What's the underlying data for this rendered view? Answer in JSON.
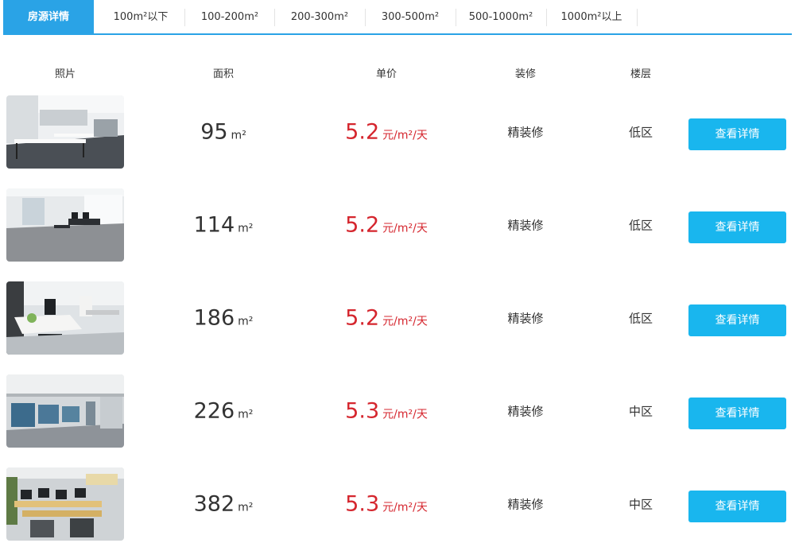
{
  "tabs": [
    {
      "label": "房源详情"
    },
    {
      "label": "100m²以下"
    },
    {
      "label": "100-200m²"
    },
    {
      "label": "200-300m²"
    },
    {
      "label": "300-500m²"
    },
    {
      "label": "500-1000m²"
    },
    {
      "label": "1000m²以上"
    }
  ],
  "columns": {
    "photo": "照片",
    "area": "面积",
    "price": "单价",
    "decoration": "装修",
    "floor": "楼层"
  },
  "colors": {
    "tab_active": "#2aa3e6",
    "price": "#d5262e",
    "button": "#19b6ee"
  },
  "listings": [
    {
      "area": "95",
      "area_unit": "m²",
      "price": "5.2",
      "price_unit": "元/m²/天",
      "decoration": "精装修",
      "floor": "低区",
      "button": "查看详情"
    },
    {
      "area": "114",
      "area_unit": "m²",
      "price": "5.2",
      "price_unit": "元/m²/天",
      "decoration": "精装修",
      "floor": "低区",
      "button": "查看详情"
    },
    {
      "area": "186",
      "area_unit": "m²",
      "price": "5.2",
      "price_unit": "元/m²/天",
      "decoration": "精装修",
      "floor": "低区",
      "button": "查看详情"
    },
    {
      "area": "226",
      "area_unit": "m²",
      "price": "5.3",
      "price_unit": "元/m²/天",
      "decoration": "精装修",
      "floor": "中区",
      "button": "查看详情"
    },
    {
      "area": "382",
      "area_unit": "m²",
      "price": "5.3",
      "price_unit": "元/m²/天",
      "decoration": "精装修",
      "floor": "中区",
      "button": "查看详情"
    }
  ]
}
